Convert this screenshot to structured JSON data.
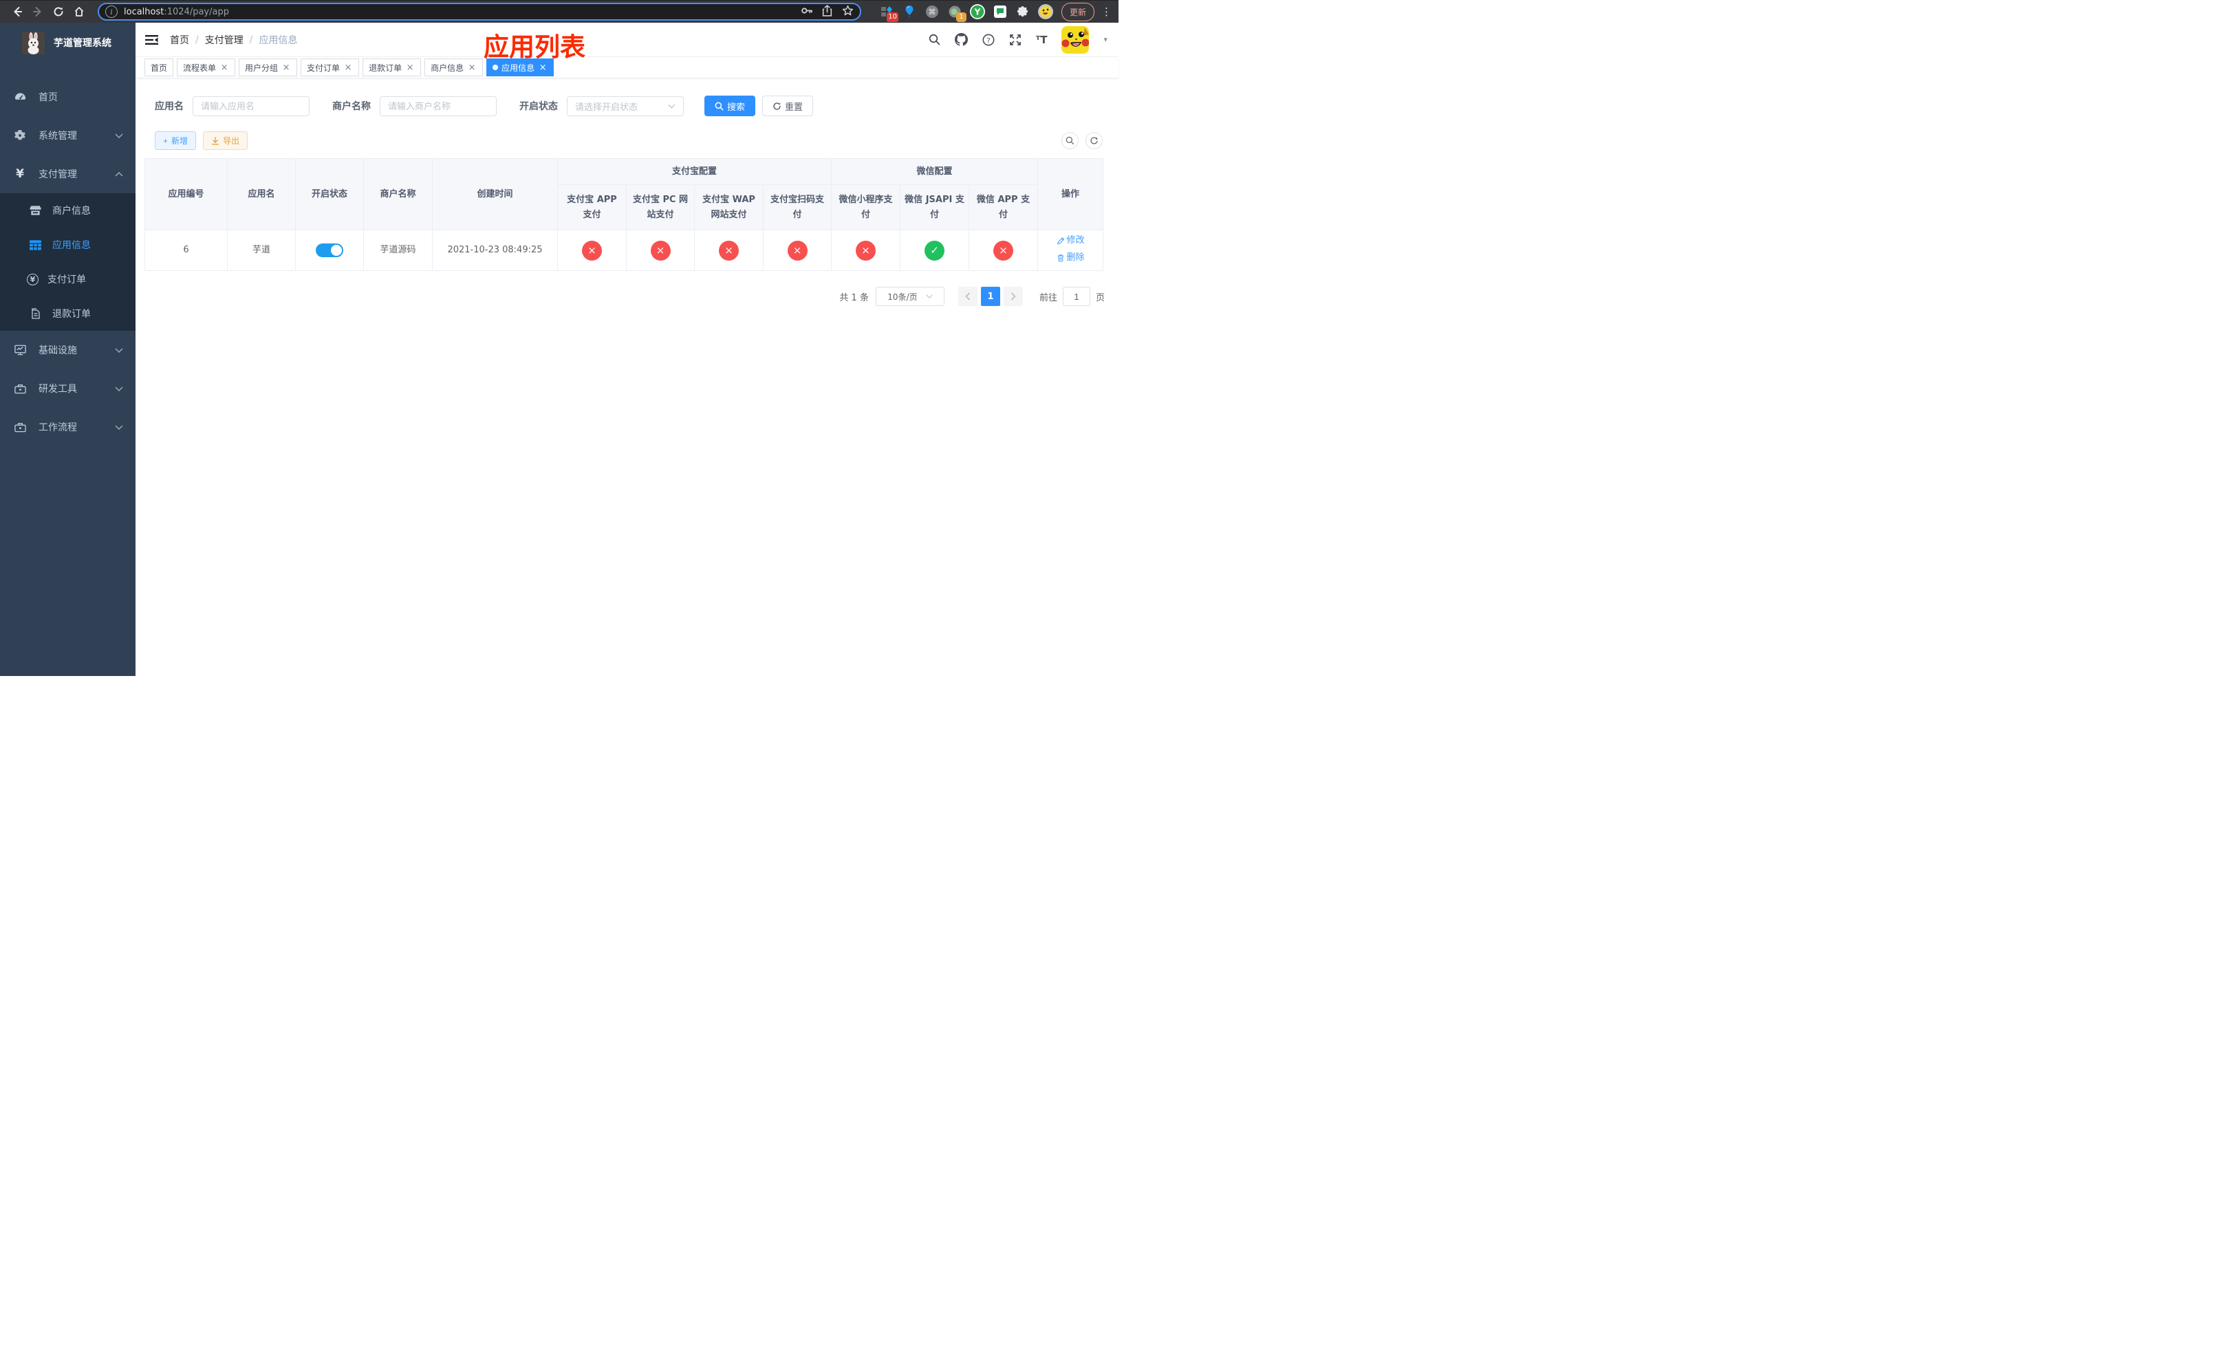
{
  "browser": {
    "url_host": "localhost",
    "url_rest": ":1024/pay/app",
    "update_label": "更新",
    "ext_badge_pin": "10",
    "ext_badge_record": "1",
    "ext_y_label": "Y"
  },
  "sidebar": {
    "title": "芋道管理系统",
    "items": [
      {
        "label": "首页"
      },
      {
        "label": "系统管理"
      },
      {
        "label": "支付管理"
      },
      {
        "label": "基础设施"
      },
      {
        "label": "研发工具"
      },
      {
        "label": "工作流程"
      }
    ],
    "payment_submenu": [
      {
        "label": "商户信息"
      },
      {
        "label": "应用信息",
        "active": true
      },
      {
        "label": "支付订单"
      },
      {
        "label": "退款订单"
      }
    ]
  },
  "navbar": {
    "breadcrumb": [
      "首页",
      "支付管理",
      "应用信息"
    ],
    "annotation": "应用列表"
  },
  "tabs": [
    {
      "label": "首页",
      "closable": false,
      "active": false
    },
    {
      "label": "流程表单",
      "closable": true,
      "active": false
    },
    {
      "label": "用户分组",
      "closable": true,
      "active": false
    },
    {
      "label": "支付订单",
      "closable": true,
      "active": false
    },
    {
      "label": "退款订单",
      "closable": true,
      "active": false
    },
    {
      "label": "商户信息",
      "closable": true,
      "active": false
    },
    {
      "label": "应用信息",
      "closable": true,
      "active": true
    }
  ],
  "filters": {
    "app_name_label": "应用名",
    "app_name_placeholder": "请输入应用名",
    "merchant_label": "商户名称",
    "merchant_placeholder": "请输入商户名称",
    "status_label": "开启状态",
    "status_placeholder": "请选择开启状态",
    "search_label": "搜索",
    "reset_label": "重置"
  },
  "toolbar": {
    "add_label": "新增",
    "export_label": "导出"
  },
  "table": {
    "plain_headers": [
      "应用编号",
      "应用名",
      "开启状态",
      "商户名称",
      "创建时间"
    ],
    "group_headers": {
      "alipay": "支付宝配置",
      "wechat": "微信配置",
      "actions": "操作"
    },
    "alipay_headers": [
      "支付宝 APP 支付",
      "支付宝 PC 网站支付",
      "支付宝 WAP 网站支付",
      "支付宝扫码支付"
    ],
    "wechat_headers": [
      "微信小程序支付",
      "微信 JSAPI 支付",
      "微信 APP 支付"
    ],
    "status_colors": {
      "ok": "#21c15f",
      "fail": "#f7504f"
    },
    "row": {
      "id": "6",
      "name": "芋道",
      "enabled": true,
      "merchant": "芋道源码",
      "created_at": "2021-10-23 08:49:25",
      "pay_channel_status": [
        false,
        false,
        false,
        false,
        false,
        true,
        false
      ],
      "edit_label": "修改",
      "delete_label": "删除"
    }
  },
  "pagination": {
    "total": "共 1 条",
    "page_size": "10条/页",
    "current_page": "1",
    "goto_prefix": "前往",
    "goto_value": "1",
    "goto_suffix": "页"
  }
}
